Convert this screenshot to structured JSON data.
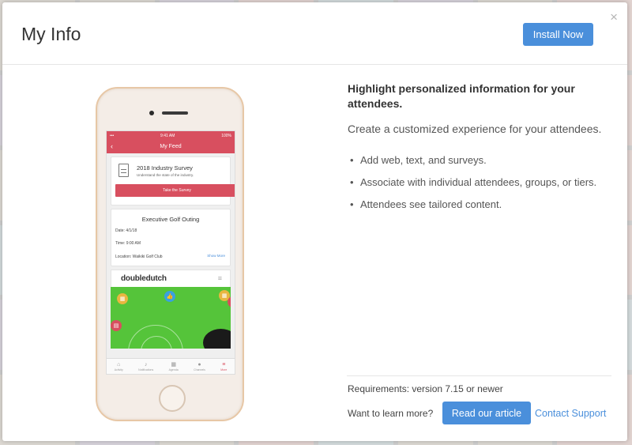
{
  "modal": {
    "title": "My Info",
    "install_label": "Install Now",
    "close_glyph": "×"
  },
  "phone": {
    "status_time": "9:41 AM",
    "status_battery": "100%",
    "nav_title": "My Feed",
    "survey": {
      "title": "2018 Industry Survey",
      "subtitle": "Understand the state of the industry.",
      "button": "Take the Survey"
    },
    "event": {
      "title": "Executive Golf Outing",
      "date": "Date: 4/1/18",
      "time": "Time: 9:00 AM",
      "location": "Location: Waikiki Golf Club",
      "show_more": "Show More"
    },
    "brand": "doubledutch",
    "tabs": [
      {
        "label": "Activity",
        "icon": "home-icon"
      },
      {
        "label": "Notifications",
        "icon": "bell-icon"
      },
      {
        "label": "Agenda",
        "icon": "calendar-icon"
      },
      {
        "label": "Channels",
        "icon": "chat-icon"
      },
      {
        "label": "More",
        "icon": "menu-icon"
      }
    ]
  },
  "info": {
    "headline": "Highlight personalized information for your attendees.",
    "description": "Create a customized experience for your attendees.",
    "features": [
      "Add web, text, and surveys.",
      "Associate with individual attendees, groups, or tiers.",
      "Attendees see tailored content."
    ],
    "requirements": "Requirements: version 7.15 or newer",
    "learn_more": "Want to learn more?",
    "read_article": "Read our article",
    "contact_support": "Contact Support"
  },
  "colors": {
    "accent": "#4a8fdb",
    "app_brand": "#d84f5f"
  }
}
